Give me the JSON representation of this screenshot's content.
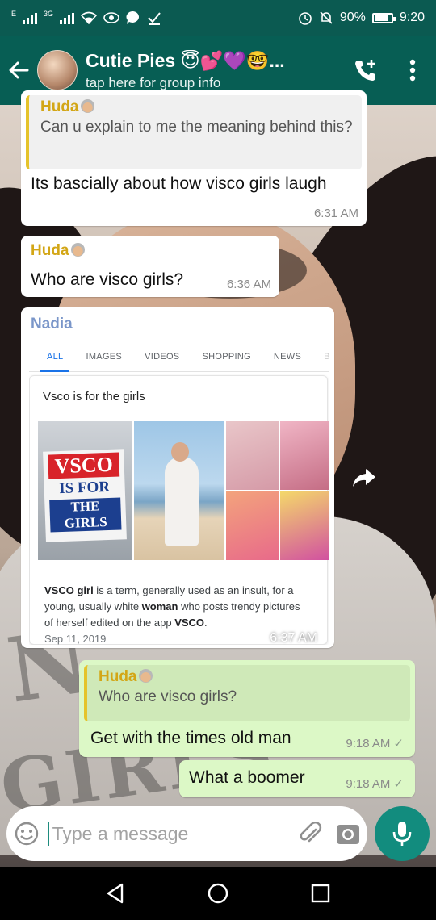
{
  "status_bar": {
    "network_label": "E",
    "network_label_2": "3G",
    "battery_percent": "90%",
    "time": "9:20"
  },
  "header": {
    "title": "Cutie Pies 😇💕💜🤓...",
    "subtitle": "tap here for group info"
  },
  "messages": [
    {
      "id": "m1",
      "quoted_sender": "Huda",
      "quoted_text": "Can u explain to me the meaning behind this?",
      "text": "Its bascially about how visco girls laugh",
      "time": "6:31 AM"
    },
    {
      "id": "m2",
      "sender": "Huda",
      "text": "Who are visco girls?",
      "time": "6:36 AM"
    },
    {
      "id": "m3",
      "sender": "Nadia",
      "time": "6:37 AM",
      "image": {
        "tabs": [
          "ALL",
          "IMAGES",
          "VIDEOS",
          "SHOPPING",
          "NEWS",
          "BO"
        ],
        "query": "Vsco is for the girls",
        "sign_lines": [
          "VSCO",
          "IS FOR",
          "THE GIRLS"
        ],
        "desc_term": "VSCO girl",
        "desc_part1": " is a term, generally used as an insult, for a young, usually white ",
        "desc_bold2": "woman",
        "desc_part2": " who posts trendy pictures of herself edited on the app ",
        "desc_bold3": "VSCO",
        "desc_end": ".",
        "date": "Sep 11, 2019"
      }
    },
    {
      "id": "m4",
      "quoted_sender": "Huda",
      "quoted_text": "Who are visco girls?",
      "text": "Get with the times old man",
      "time": "9:18 AM",
      "status": "✓"
    },
    {
      "id": "m5",
      "text": "What a boomer",
      "time": "9:18 AM",
      "status": "✓"
    }
  ],
  "input": {
    "placeholder": "Type a message"
  },
  "colors": {
    "header": "#075e54",
    "status_bar": "#0b5a51",
    "outgoing_bubble": "#dcf8c6",
    "huda_name": "#d3a616",
    "nadia_name": "#7a96c9",
    "mic_button": "#128c7e"
  },
  "icons": [
    "back-arrow-icon",
    "add-call-icon",
    "more-vert-icon",
    "forward-icon",
    "emoji-icon",
    "attach-icon",
    "camera-icon",
    "mic-icon",
    "nav-back-icon",
    "nav-home-icon",
    "nav-recents-icon"
  ]
}
